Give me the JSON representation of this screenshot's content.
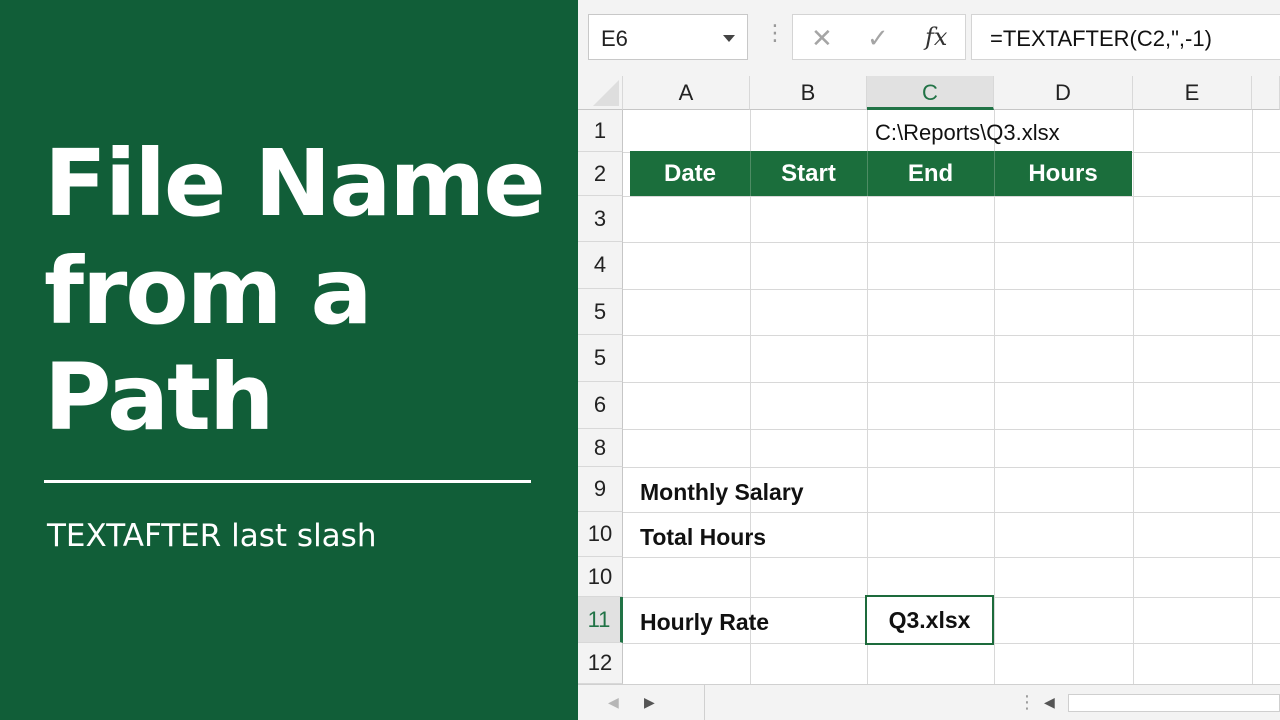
{
  "title_panel": {
    "title_lines": [
      "File Name",
      "from a",
      "Path"
    ],
    "subtitle": "TEXTAFTER last slash",
    "background_color": "#115e38"
  },
  "formula_bar": {
    "name_box": "E6",
    "cancel_icon": "✕",
    "enter_icon": "✓",
    "insert_function_label": "fx",
    "formula": "=TEXTAFTER(C2,\",-1)"
  },
  "sheet": {
    "columns": [
      "A",
      "B",
      "C",
      "D",
      "E"
    ],
    "selected_column": "C",
    "row_headers": [
      "1",
      "2",
      "3",
      "4",
      "5",
      "5",
      "6",
      "8",
      "9",
      "10",
      "10",
      "11",
      "12"
    ],
    "selected_row": "11",
    "path_value": "C:\\Reports\\Q3.xlsx",
    "table_headers": [
      "Date",
      "Start",
      "End",
      "Hours"
    ],
    "labels": {
      "monthly_salary": "Monthly Salary",
      "total_hours": "Total Hours",
      "hourly_rate": "Hourly Rate"
    },
    "result_value": "Q3.xlsx",
    "accent_color": "#1b6e3c"
  }
}
